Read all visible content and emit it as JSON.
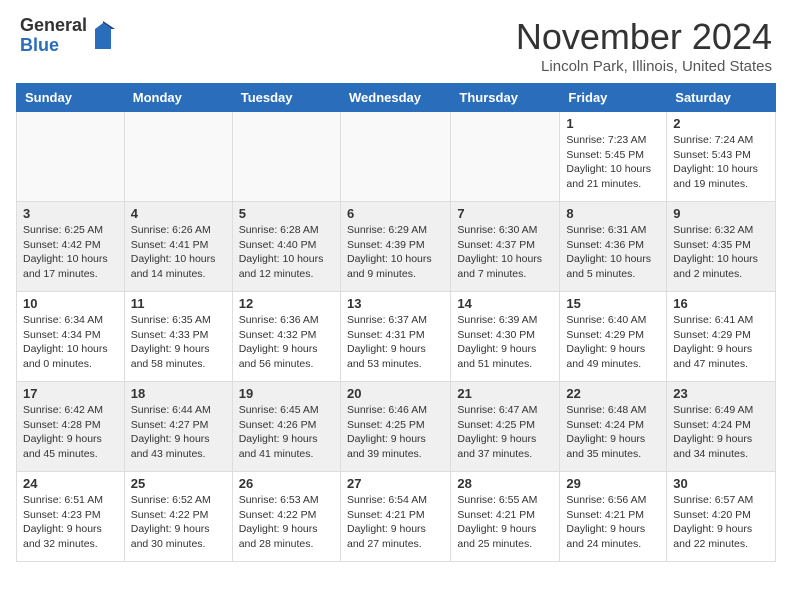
{
  "logo": {
    "general": "General",
    "blue": "Blue"
  },
  "header": {
    "month_year": "November 2024",
    "location": "Lincoln Park, Illinois, United States"
  },
  "days_of_week": [
    "Sunday",
    "Monday",
    "Tuesday",
    "Wednesday",
    "Thursday",
    "Friday",
    "Saturday"
  ],
  "weeks": [
    [
      {
        "day": "",
        "empty": true
      },
      {
        "day": "",
        "empty": true
      },
      {
        "day": "",
        "empty": true
      },
      {
        "day": "",
        "empty": true
      },
      {
        "day": "",
        "empty": true
      },
      {
        "day": "1",
        "sunrise": "7:23 AM",
        "sunset": "5:45 PM",
        "daylight": "10 hours and 21 minutes."
      },
      {
        "day": "2",
        "sunrise": "7:24 AM",
        "sunset": "5:43 PM",
        "daylight": "10 hours and 19 minutes."
      }
    ],
    [
      {
        "day": "3",
        "sunrise": "6:25 AM",
        "sunset": "4:42 PM",
        "daylight": "10 hours and 17 minutes."
      },
      {
        "day": "4",
        "sunrise": "6:26 AM",
        "sunset": "4:41 PM",
        "daylight": "10 hours and 14 minutes."
      },
      {
        "day": "5",
        "sunrise": "6:28 AM",
        "sunset": "4:40 PM",
        "daylight": "10 hours and 12 minutes."
      },
      {
        "day": "6",
        "sunrise": "6:29 AM",
        "sunset": "4:39 PM",
        "daylight": "10 hours and 9 minutes."
      },
      {
        "day": "7",
        "sunrise": "6:30 AM",
        "sunset": "4:37 PM",
        "daylight": "10 hours and 7 minutes."
      },
      {
        "day": "8",
        "sunrise": "6:31 AM",
        "sunset": "4:36 PM",
        "daylight": "10 hours and 5 minutes."
      },
      {
        "day": "9",
        "sunrise": "6:32 AM",
        "sunset": "4:35 PM",
        "daylight": "10 hours and 2 minutes."
      }
    ],
    [
      {
        "day": "10",
        "sunrise": "6:34 AM",
        "sunset": "4:34 PM",
        "daylight": "10 hours and 0 minutes."
      },
      {
        "day": "11",
        "sunrise": "6:35 AM",
        "sunset": "4:33 PM",
        "daylight": "9 hours and 58 minutes."
      },
      {
        "day": "12",
        "sunrise": "6:36 AM",
        "sunset": "4:32 PM",
        "daylight": "9 hours and 56 minutes."
      },
      {
        "day": "13",
        "sunrise": "6:37 AM",
        "sunset": "4:31 PM",
        "daylight": "9 hours and 53 minutes."
      },
      {
        "day": "14",
        "sunrise": "6:39 AM",
        "sunset": "4:30 PM",
        "daylight": "9 hours and 51 minutes."
      },
      {
        "day": "15",
        "sunrise": "6:40 AM",
        "sunset": "4:29 PM",
        "daylight": "9 hours and 49 minutes."
      },
      {
        "day": "16",
        "sunrise": "6:41 AM",
        "sunset": "4:29 PM",
        "daylight": "9 hours and 47 minutes."
      }
    ],
    [
      {
        "day": "17",
        "sunrise": "6:42 AM",
        "sunset": "4:28 PM",
        "daylight": "9 hours and 45 minutes."
      },
      {
        "day": "18",
        "sunrise": "6:44 AM",
        "sunset": "4:27 PM",
        "daylight": "9 hours and 43 minutes."
      },
      {
        "day": "19",
        "sunrise": "6:45 AM",
        "sunset": "4:26 PM",
        "daylight": "9 hours and 41 minutes."
      },
      {
        "day": "20",
        "sunrise": "6:46 AM",
        "sunset": "4:25 PM",
        "daylight": "9 hours and 39 minutes."
      },
      {
        "day": "21",
        "sunrise": "6:47 AM",
        "sunset": "4:25 PM",
        "daylight": "9 hours and 37 minutes."
      },
      {
        "day": "22",
        "sunrise": "6:48 AM",
        "sunset": "4:24 PM",
        "daylight": "9 hours and 35 minutes."
      },
      {
        "day": "23",
        "sunrise": "6:49 AM",
        "sunset": "4:24 PM",
        "daylight": "9 hours and 34 minutes."
      }
    ],
    [
      {
        "day": "24",
        "sunrise": "6:51 AM",
        "sunset": "4:23 PM",
        "daylight": "9 hours and 32 minutes."
      },
      {
        "day": "25",
        "sunrise": "6:52 AM",
        "sunset": "4:22 PM",
        "daylight": "9 hours and 30 minutes."
      },
      {
        "day": "26",
        "sunrise": "6:53 AM",
        "sunset": "4:22 PM",
        "daylight": "9 hours and 28 minutes."
      },
      {
        "day": "27",
        "sunrise": "6:54 AM",
        "sunset": "4:21 PM",
        "daylight": "9 hours and 27 minutes."
      },
      {
        "day": "28",
        "sunrise": "6:55 AM",
        "sunset": "4:21 PM",
        "daylight": "9 hours and 25 minutes."
      },
      {
        "day": "29",
        "sunrise": "6:56 AM",
        "sunset": "4:21 PM",
        "daylight": "9 hours and 24 minutes."
      },
      {
        "day": "30",
        "sunrise": "6:57 AM",
        "sunset": "4:20 PM",
        "daylight": "9 hours and 22 minutes."
      }
    ]
  ],
  "labels": {
    "sunrise": "Sunrise:",
    "sunset": "Sunset:",
    "daylight": "Daylight:"
  }
}
